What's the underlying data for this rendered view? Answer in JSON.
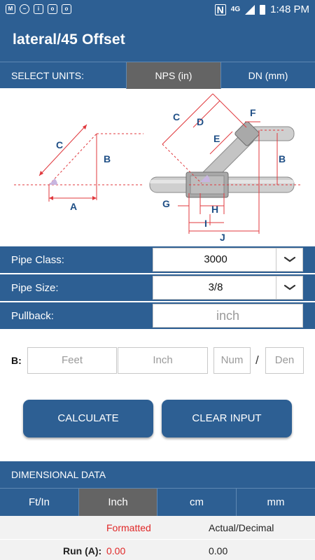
{
  "status_bar": {
    "time": "1:48 PM",
    "network": "4G",
    "left_icons": [
      "gmail-icon",
      "messenger-icon",
      "imdb-icon",
      "instagram-icon",
      "instagram-icon"
    ],
    "right_icons": [
      "nfc-icon",
      "signal-icon",
      "battery-icon"
    ]
  },
  "app_bar": {
    "title": "lateral/45 Offset"
  },
  "units": {
    "label": "SELECT UNITS:",
    "options": [
      "NPS (in)",
      "DN (mm)"
    ],
    "selected": "NPS (in)"
  },
  "diagram": {
    "triangle_labels": {
      "c": "C",
      "b": "B",
      "a": "A"
    },
    "pipe_labels": {
      "c": "C",
      "d": "D",
      "e": "E",
      "f": "F",
      "b": "B",
      "g": "G",
      "h": "H",
      "i": "I",
      "j": "J"
    },
    "colors": {
      "dimension": "#e0393e",
      "label": "#1f4f86",
      "pipe": "#c9c9c9"
    }
  },
  "form": {
    "pipe_class": {
      "label": "Pipe Class:",
      "value": "3000"
    },
    "pipe_size": {
      "label": "Pipe Size:",
      "value": "3/8"
    },
    "pullback": {
      "label": "Pullback:",
      "placeholder": "inch"
    }
  },
  "b_input": {
    "label": "B:",
    "feet_placeholder": "Feet",
    "inch_placeholder": "Inch",
    "num_placeholder": "Num",
    "den_placeholder": "Den",
    "slash": "/"
  },
  "buttons": {
    "calculate": "CALCULATE",
    "clear": "CLEAR INPUT"
  },
  "dimensional": {
    "header": "DIMENSIONAL DATA",
    "tabs": [
      "Ft/In",
      "Inch",
      "cm",
      "mm"
    ],
    "selected_tab": "Inch",
    "col_formatted": "Formatted",
    "col_actual": "Actual/Decimal",
    "rows": [
      {
        "label": "Run (A):",
        "formatted": "0.00",
        "actual": "0.00"
      }
    ]
  },
  "colors": {
    "primary": "#2d5f93",
    "selected": "#646464",
    "accent_red": "#e02828"
  }
}
